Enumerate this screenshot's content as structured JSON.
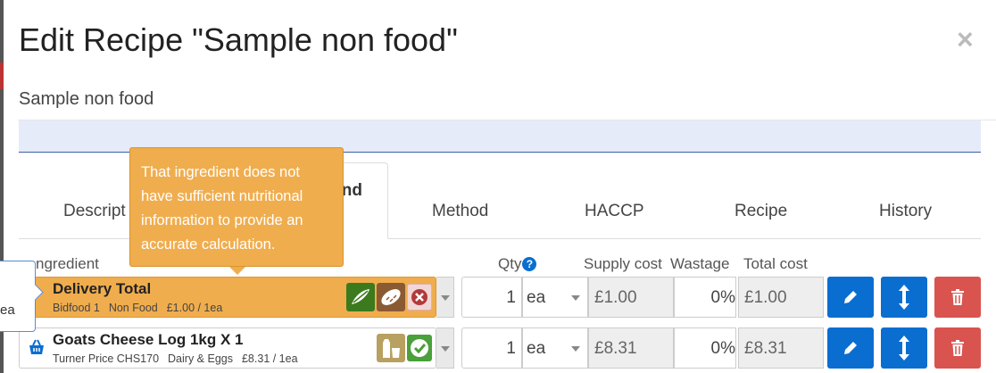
{
  "modal": {
    "title": "Edit Recipe \"Sample non food\"",
    "close": "×",
    "subtitle": "Sample non food"
  },
  "tabs": [
    {
      "label": "Descript"
    },
    {
      "label": "nd"
    },
    {
      "label": "Method"
    },
    {
      "label": "HACCP"
    },
    {
      "label": "Recipe"
    },
    {
      "label": "History"
    }
  ],
  "tooltip": {
    "text": "That ingredient does not have sufficient nutritional information to provide an accurate calculation."
  },
  "columns": {
    "ingredient": "ngredient",
    "qty": "Qty",
    "qty_help": "?",
    "supply_cost": "Supply cost",
    "wastage": "Wastage",
    "total_cost": "Total cost"
  },
  "popover_fragment": "ea",
  "rows": [
    {
      "name": "Delivery Total",
      "supplier": "Bidfood 1",
      "category": "Non Food",
      "price": "£1.00 / 1ea",
      "qty": "1",
      "unit": "ea",
      "supply_cost": "£1.00",
      "wastage": "0",
      "wastage_unit": "%",
      "total_cost": "£1.00",
      "badges": [
        "vegetable-icon",
        "bread-icon",
        "cross-icon"
      ],
      "highlight": true
    },
    {
      "name": "Goats Cheese Log 1kg X 1",
      "supplier": "Turner Price CHS170",
      "category": "Dairy & Eggs",
      "price": "£8.31 / 1ea",
      "qty": "1",
      "unit": "ea",
      "supply_cost": "£8.31",
      "wastage": "0",
      "wastage_unit": "%",
      "total_cost": "£8.31",
      "badges": [
        "milk-icon",
        "check-icon"
      ],
      "highlight": false
    }
  ],
  "colors": {
    "accent_blue": "#0a6ed1",
    "warning_orange": "#f0ad4e",
    "danger_red": "#d9534f",
    "band_blue": "#e6ebfa"
  }
}
